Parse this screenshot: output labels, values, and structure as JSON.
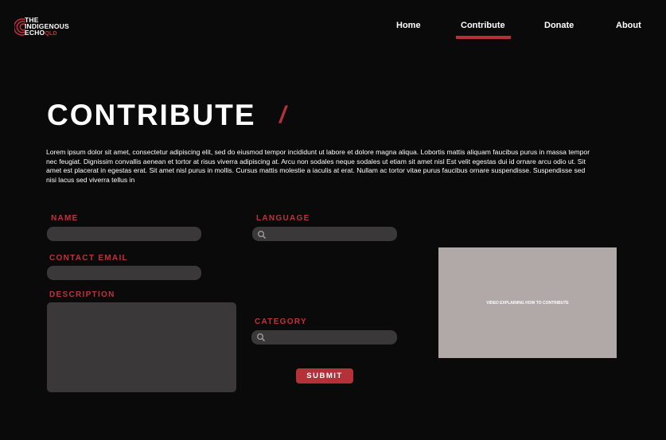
{
  "logo": {
    "line1": "THE",
    "line2": "INDIGENOUS",
    "line3": "ECHO",
    "line3_suffix": "QLD"
  },
  "nav": {
    "home": "Home",
    "contribute": "Contribute",
    "donate": "Donate",
    "about": "About"
  },
  "page": {
    "title": "CONTRIBUTE",
    "slash": "/",
    "intro": "Lorem ipsum dolor sit amet, consectetur adipiscing elit, sed do eiusmod tempor incididunt ut labore et dolore magna aliqua. Lobortis mattis aliquam faucibus purus in massa tempor nec feugiat. Dignissim convallis aenean et tortor at risus viverra adipiscing at. Arcu non sodales neque sodales ut etiam sit amet nisl Est velit egestas dui id ornare arcu odio ut. Sit amet est placerat in egestas erat. Sit amet nisl purus in mollis. Cursus mattis molestie a iaculis at erat. Nullam ac tortor vitae purus faucibus ornare suspendisse. Suspendisse sed nisi lacus sed viverra tellus in"
  },
  "form": {
    "name_label": "NAME",
    "name_value": "",
    "email_label": "CONTACT EMAIL",
    "email_value": "",
    "description_label": "DESCRIPTION",
    "description_value": "",
    "language_label": "LANGUAGE",
    "language_value": "",
    "category_label": "CATEGORY",
    "category_value": "",
    "submit_label": "SUBMIT"
  },
  "video": {
    "caption": "VIDEO EXPLAINING HOW TO CONTRIBUTE"
  },
  "colors": {
    "accent": "#b5313a",
    "background": "#0a0a0a",
    "field": "#3a3838",
    "video_bg": "#b1a8a8"
  },
  "icons": {
    "logo_mark": "concentric-arcs-icon",
    "search": "magnifier-icon"
  }
}
